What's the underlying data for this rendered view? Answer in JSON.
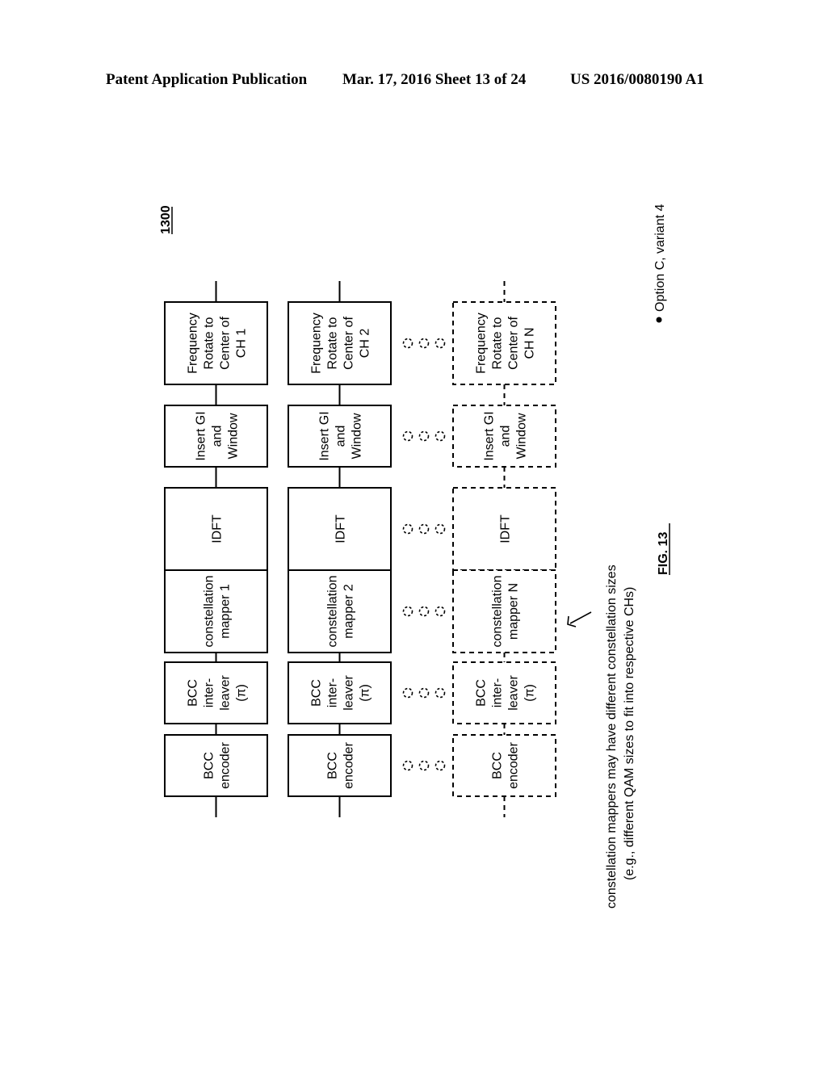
{
  "header": {
    "left": "Patent Application Publication",
    "middle": "Mar. 17, 2016  Sheet 13 of 24",
    "right": "US 2016/0080190 A1"
  },
  "figure": {
    "reference_number": "1300",
    "caption": "FIG. 13",
    "bullet_note": "Option C, variant 4",
    "annotation": {
      "line1": "constellation mappers may have different constellation sizes",
      "line2": "(e.g., different QAM sizes to fit into respective CHs)"
    },
    "chains": [
      {
        "id": "ch1",
        "style": "solid",
        "blocks": {
          "encoder": [
            "BCC",
            "encoder"
          ],
          "interleaver": [
            "BCC",
            "inter-",
            "leaver",
            "(π)"
          ],
          "mapper": [
            "constellation",
            "mapper 1"
          ],
          "idft": [
            "IDFT"
          ],
          "gi": [
            "Insert GI",
            "and",
            "Window"
          ],
          "rotate": [
            "Frequency",
            "Rotate to",
            "Center of",
            "CH 1"
          ]
        }
      },
      {
        "id": "ch2",
        "style": "solid",
        "blocks": {
          "encoder": [
            "BCC",
            "encoder"
          ],
          "interleaver": [
            "BCC",
            "inter-",
            "leaver",
            "(π)"
          ],
          "mapper": [
            "constellation",
            "mapper 2"
          ],
          "idft": [
            "IDFT"
          ],
          "gi": [
            "Insert GI",
            "and",
            "Window"
          ],
          "rotate": [
            "Frequency",
            "Rotate to",
            "Center of",
            "CH 2"
          ]
        }
      },
      {
        "id": "chN",
        "style": "dashed",
        "blocks": {
          "encoder": [
            "BCC",
            "encoder"
          ],
          "interleaver": [
            "BCC",
            "inter-",
            "leaver",
            "(π)"
          ],
          "mapper": [
            "constellation",
            "mapper N"
          ],
          "idft": [
            "IDFT"
          ],
          "gi": [
            "Insert GI",
            "and",
            "Window"
          ],
          "rotate": [
            "Frequency",
            "Rotate to",
            "Center of",
            "CH N"
          ]
        }
      }
    ],
    "ellipsis_glyph": "continuation-dots"
  }
}
